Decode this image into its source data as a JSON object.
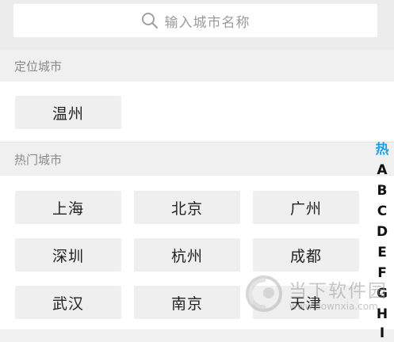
{
  "search": {
    "placeholder": "输入城市名称",
    "icon": "search-icon"
  },
  "location_section": {
    "title": "定位城市",
    "cities": [
      "温州"
    ]
  },
  "hot_section": {
    "title": "热门城市",
    "cities": [
      "上海",
      "北京",
      "广州",
      "深圳",
      "杭州",
      "成都",
      "武汉",
      "南京",
      "天津"
    ]
  },
  "index_bar": {
    "items": [
      "热",
      "A",
      "B",
      "C",
      "D",
      "E",
      "F",
      "G",
      "H",
      "I"
    ],
    "active_color": "#1aa3e8"
  },
  "watermark": {
    "text": "当下软件园",
    "url": "www.downxia.com"
  }
}
